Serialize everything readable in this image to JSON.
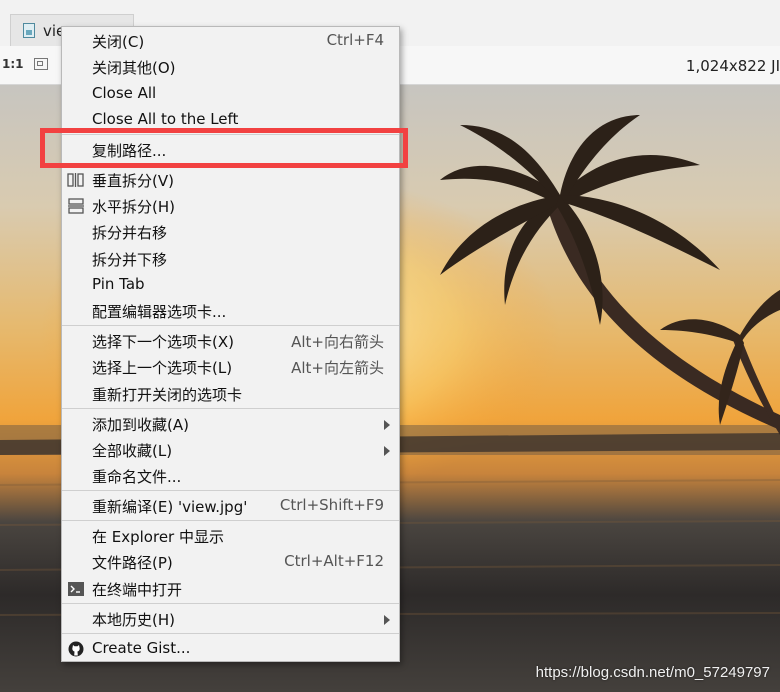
{
  "tab": {
    "label": "view.jpg",
    "visible_text": "vie"
  },
  "toolbar": {
    "zoom": "1:1",
    "image_info": "1,024x822 JI"
  },
  "watermark": "https://blog.csdn.net/m0_57249797",
  "menu": {
    "close": "关闭(C)",
    "close_shortcut": "Ctrl+F4",
    "close_others": "关闭其他(O)",
    "close_all": "Close All",
    "close_all_left": "Close All to the Left",
    "copy_path": "复制路径...",
    "split_vertical": "垂直拆分(V)",
    "split_horizontal": "水平拆分(H)",
    "split_move_right": "拆分并右移",
    "split_move_down": "拆分并下移",
    "pin_tab": "Pin Tab",
    "configure_tabs": "配置编辑器选项卡...",
    "select_next": "选择下一个选项卡(X)",
    "select_next_shortcut": "Alt+向右箭头",
    "select_prev": "选择上一个选项卡(L)",
    "select_prev_shortcut": "Alt+向左箭头",
    "reopen_closed": "重新打开关闭的选项卡",
    "add_favorites": "添加到收藏(A)",
    "all_favorites": "全部收藏(L)",
    "rename_file": "重命名文件...",
    "recompile": "重新编译(E) 'view.jpg'",
    "recompile_shortcut": "Ctrl+Shift+F9",
    "show_explorer": "在 Explorer 中显示",
    "file_path": "文件路径(P)",
    "file_path_shortcut": "Ctrl+Alt+F12",
    "open_terminal": "在终端中打开",
    "local_history": "本地历史(H)",
    "create_gist": "Create Gist..."
  },
  "colors": {
    "highlight_border": "#f24141",
    "menu_bg": "#f2f2f2"
  }
}
